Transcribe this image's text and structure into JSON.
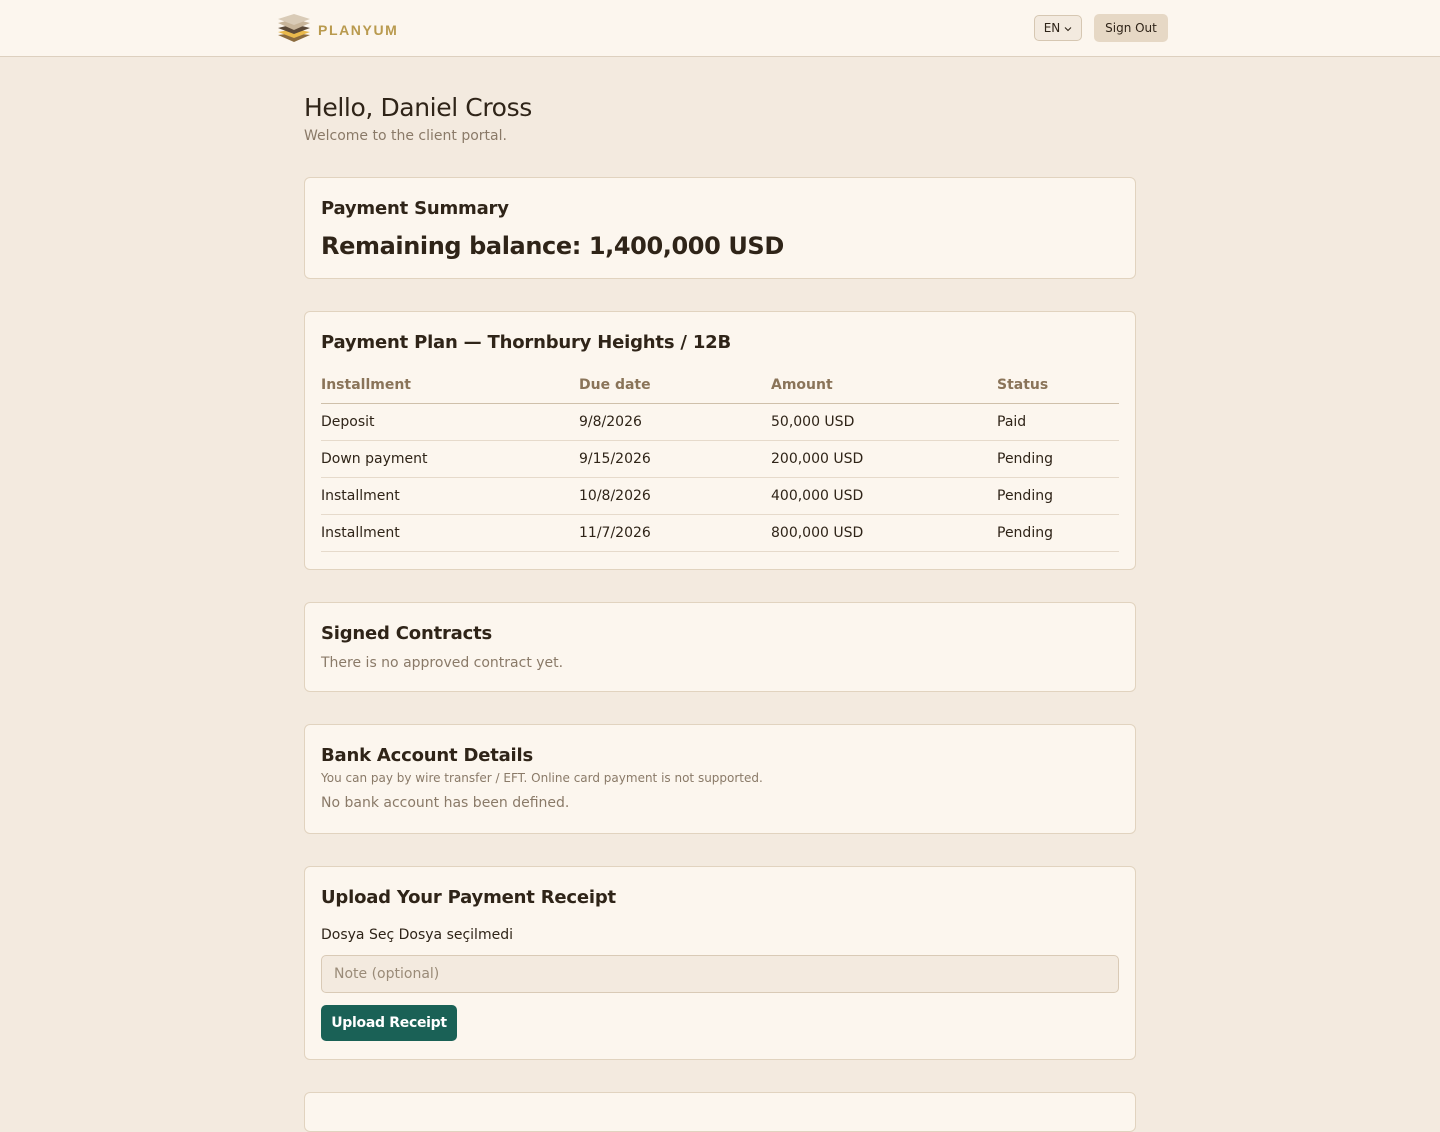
{
  "header": {
    "brand_name": "PLANYUM",
    "language": "EN",
    "sign_out_label": "Sign Out"
  },
  "greeting": {
    "title": "Hello, Daniel Cross",
    "subtitle": "Welcome to the client portal."
  },
  "payment_summary": {
    "title": "Payment Summary",
    "balance": "Remaining balance: 1,400,000 USD"
  },
  "payment_plan": {
    "title": "Payment Plan — Thornbury Heights / 12B",
    "columns": [
      "Installment",
      "Due date",
      "Amount",
      "Status"
    ],
    "rows": [
      [
        "Deposit",
        "9/8/2026",
        "50,000 USD",
        "Paid"
      ],
      [
        "Down payment",
        "9/15/2026",
        "200,000 USD",
        "Pending"
      ],
      [
        "Installment",
        "10/8/2026",
        "400,000 USD",
        "Pending"
      ],
      [
        "Installment",
        "11/7/2026",
        "800,000 USD",
        "Pending"
      ]
    ]
  },
  "contracts": {
    "title": "Signed Contracts",
    "empty_text": "There is no approved contract yet."
  },
  "bank": {
    "title": "Bank Account Details",
    "info": "You can pay by wire transfer / EFT. Online card payment is not supported.",
    "empty_text": "No bank account has been defined."
  },
  "upload": {
    "title": "Upload Your Payment Receipt",
    "choose_file_label": "Dosya Seç",
    "no_file_label": "Dosya seçilmedi",
    "note_placeholder": "Note (optional)",
    "submit_label": "Upload Receipt"
  }
}
